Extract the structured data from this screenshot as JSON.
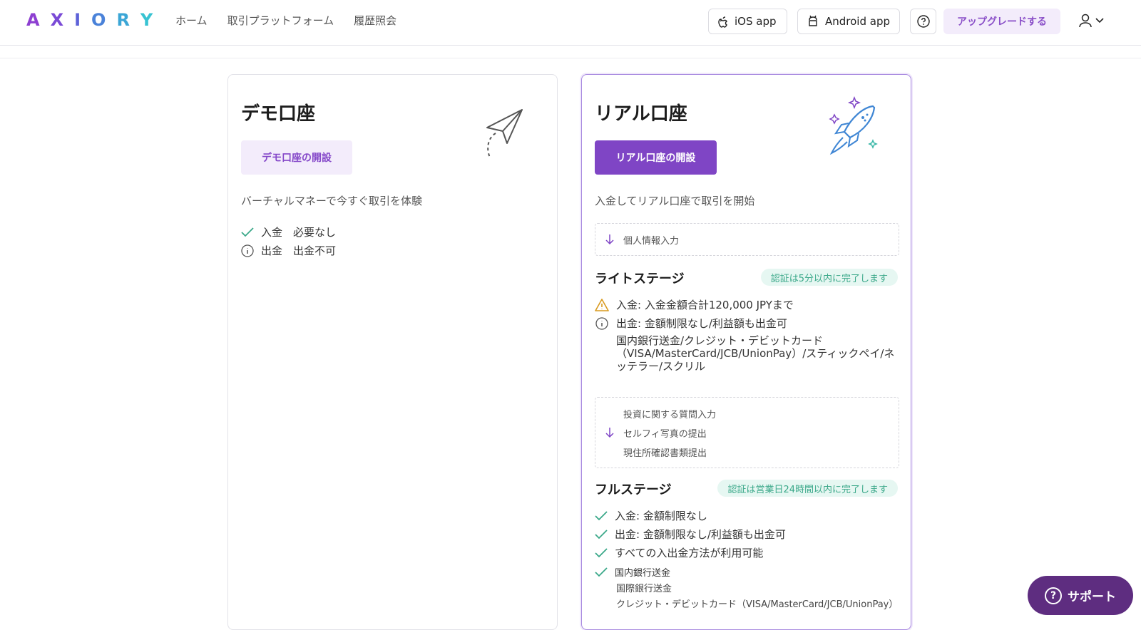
{
  "header": {
    "logo_letters": [
      "A",
      "X",
      "I",
      "O",
      "R",
      "Y"
    ],
    "logo_colors": [
      "#8d3fd1",
      "#7a4ad6",
      "#5d62d8",
      "#4a82d9",
      "#3ba6d6",
      "#38c3d2"
    ],
    "nav": [
      "ホーム",
      "取引プラットフォーム",
      "履歴照会"
    ],
    "ios_label": "iOS app",
    "android_label": "Android app",
    "upgrade_label": "アップグレードする"
  },
  "demo": {
    "title": "デモ口座",
    "button": "デモ口座の開設",
    "description": "バーチャルマネーで今すぐ取引を体験",
    "rows": [
      {
        "icon": "check-icon",
        "text": "入金　必要なし"
      },
      {
        "icon": "info-icon",
        "text": "出金　出金不可"
      }
    ]
  },
  "real": {
    "title": "リアル口座",
    "button": "リアル口座の開設",
    "description": "入金してリアル口座で取引を開始",
    "step1": "個人情報入力",
    "light_stage": {
      "title": "ライトステージ",
      "badge": "認証は5分以内に完了します",
      "deposit": "入金: 入金金額合計120,000 JPYまで",
      "withdraw": "出金: 金額制限なし/利益額も出金可",
      "methods": "国内銀行送金/クレジット・デビットカード（VISA/MasterCard/JCB/UnionPay）/スティックペイ/ネッテラー/スクリル"
    },
    "steps2": [
      "投資に関する質問入力",
      "セルフィ写真の提出",
      "現住所確認書類提出"
    ],
    "full_stage": {
      "title": "フルステージ",
      "badge": "認証は営業日24時間以内に完了します",
      "deposit": "入金: 金額制限なし",
      "withdraw": "出金: 金額制限なし/利益額も出金可",
      "all_methods": "すべての入出金方法が利用可能",
      "methods": [
        "国内銀行送金",
        "国際銀行送金",
        "クレジット・デビットカード（VISA/MasterCard/JCB/UnionPay）"
      ]
    }
  },
  "support_label": "サポート",
  "colors": {
    "purple": "#7f45c5",
    "green": "#3aa889",
    "warn": "#d99a1f"
  }
}
